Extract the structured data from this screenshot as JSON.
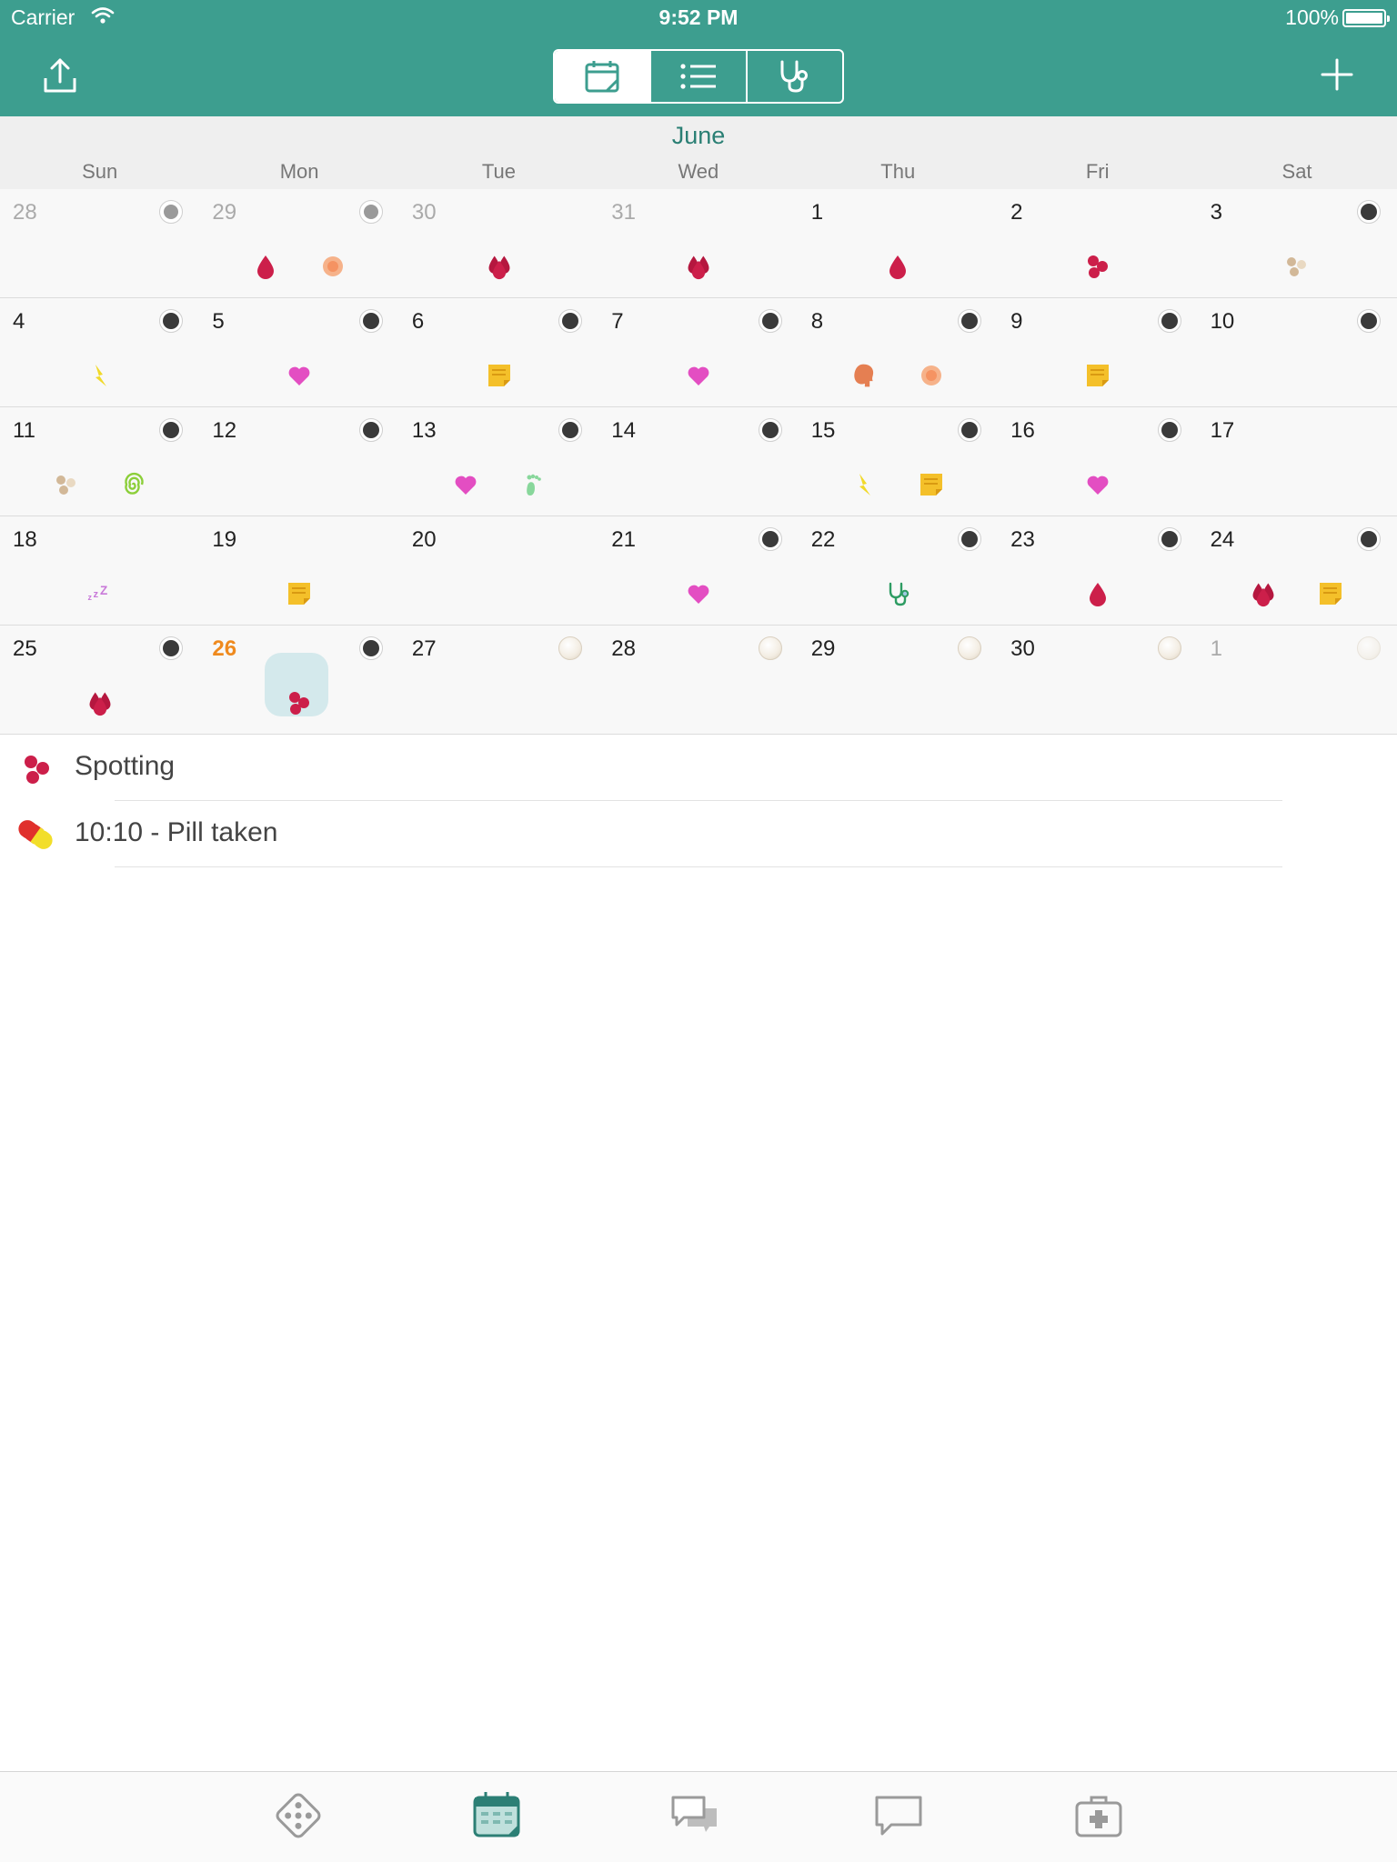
{
  "status_bar": {
    "carrier": "Carrier",
    "time": "9:52 PM",
    "battery": "100%"
  },
  "toolbar": {
    "segments": [
      {
        "icon": "calendar-icon",
        "active": true
      },
      {
        "icon": "list-icon",
        "active": false
      },
      {
        "icon": "stethoscope-icon",
        "active": false
      }
    ]
  },
  "calendar": {
    "month": "June",
    "weekdays": [
      "Sun",
      "Mon",
      "Tue",
      "Wed",
      "Thu",
      "Fri",
      "Sat"
    ],
    "weeks": [
      [
        {
          "n": "28",
          "muted": true,
          "badge": "faded",
          "icons": []
        },
        {
          "n": "29",
          "muted": true,
          "badge": "faded",
          "icons": [
            "blood-drop-icon",
            "peach-dot-icon"
          ]
        },
        {
          "n": "30",
          "muted": true,
          "badge": "",
          "icons": [
            "heavy-blood-icon"
          ]
        },
        {
          "n": "31",
          "muted": true,
          "badge": "",
          "icons": [
            "heavy-blood-icon"
          ]
        },
        {
          "n": "1",
          "badge": "",
          "icons": [
            "blood-drop-icon"
          ]
        },
        {
          "n": "2",
          "badge": "",
          "icons": [
            "spotting-icon"
          ]
        },
        {
          "n": "3",
          "badge": "dark",
          "icons": [
            "beige-dots-icon"
          ]
        }
      ],
      [
        {
          "n": "4",
          "badge": "dark",
          "icons": [
            "lightning-icon"
          ]
        },
        {
          "n": "5",
          "badge": "dark",
          "icons": [
            "heart-icon"
          ]
        },
        {
          "n": "6",
          "badge": "dark",
          "icons": [
            "note-icon"
          ]
        },
        {
          "n": "7",
          "badge": "dark",
          "icons": [
            "heart-icon"
          ]
        },
        {
          "n": "8",
          "badge": "dark",
          "icons": [
            "head-icon",
            "peach-dot-icon"
          ]
        },
        {
          "n": "9",
          "badge": "dark",
          "icons": [
            "note-icon"
          ]
        },
        {
          "n": "10",
          "badge": "dark",
          "icons": []
        }
      ],
      [
        {
          "n": "11",
          "badge": "dark",
          "icons": [
            "beige-dots-icon",
            "spiral-icon"
          ]
        },
        {
          "n": "12",
          "badge": "dark",
          "icons": []
        },
        {
          "n": "13",
          "badge": "dark",
          "icons": [
            "heart-icon",
            "foot-icon"
          ]
        },
        {
          "n": "14",
          "badge": "dark",
          "icons": []
        },
        {
          "n": "15",
          "badge": "dark",
          "icons": [
            "lightning-icon",
            "note-icon"
          ]
        },
        {
          "n": "16",
          "badge": "dark",
          "icons": [
            "heart-icon"
          ]
        },
        {
          "n": "17",
          "badge": "",
          "icons": []
        }
      ],
      [
        {
          "n": "18",
          "badge": "",
          "icons": [
            "sleep-icon"
          ]
        },
        {
          "n": "19",
          "badge": "",
          "icons": [
            "note-icon"
          ]
        },
        {
          "n": "20",
          "badge": "",
          "icons": []
        },
        {
          "n": "21",
          "badge": "dark",
          "icons": [
            "heart-icon"
          ]
        },
        {
          "n": "22",
          "badge": "dark",
          "icons": [
            "stethoscope-small-icon"
          ]
        },
        {
          "n": "23",
          "badge": "dark",
          "icons": [
            "blood-drop-icon"
          ]
        },
        {
          "n": "24",
          "badge": "dark",
          "icons": [
            "heavy-blood-icon",
            "note-icon"
          ]
        }
      ],
      [
        {
          "n": "25",
          "badge": "dark",
          "icons": [
            "heavy-blood-icon"
          ]
        },
        {
          "n": "26",
          "today": true,
          "badge": "dark",
          "icons": [
            "spotting-icon"
          ]
        },
        {
          "n": "27",
          "badge": "pearl",
          "icons": []
        },
        {
          "n": "28",
          "badge": "pearl",
          "icons": []
        },
        {
          "n": "29",
          "badge": "pearl",
          "icons": []
        },
        {
          "n": "30",
          "badge": "pearl",
          "icons": []
        },
        {
          "n": "1",
          "muted": true,
          "badge": "pearl-faded",
          "icons": []
        }
      ]
    ]
  },
  "details": [
    {
      "icon": "spotting-icon",
      "text": "Spotting"
    },
    {
      "icon": "pill-icon",
      "text": "10:10 - Pill taken"
    }
  ],
  "tabbar": {
    "tabs": [
      {
        "icon": "pill-pack-icon",
        "active": false
      },
      {
        "icon": "calendar-tab-icon",
        "active": true
      },
      {
        "icon": "chat-bubbles-icon",
        "active": false
      },
      {
        "icon": "message-icon",
        "active": false
      },
      {
        "icon": "first-aid-icon",
        "active": false
      }
    ]
  },
  "colors": {
    "accent": "#3d9e8f",
    "today": "#ef8a1e",
    "blood": "#cc1f4a",
    "heart": "#e34ec2",
    "note": "#f4c02a"
  }
}
